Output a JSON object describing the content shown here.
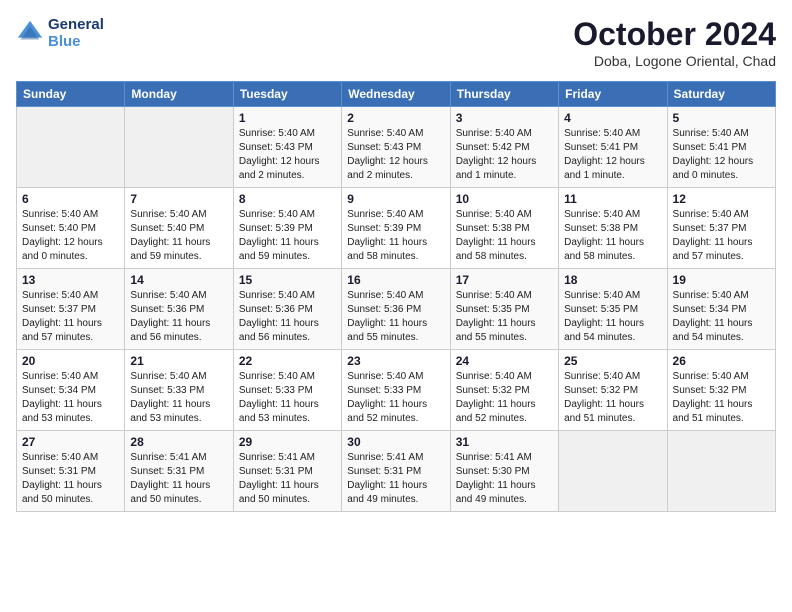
{
  "header": {
    "logo_line1": "General",
    "logo_line2": "Blue",
    "month": "October 2024",
    "location": "Doba, Logone Oriental, Chad"
  },
  "weekdays": [
    "Sunday",
    "Monday",
    "Tuesday",
    "Wednesday",
    "Thursday",
    "Friday",
    "Saturday"
  ],
  "weeks": [
    [
      {
        "day": "",
        "sunrise": "",
        "sunset": "",
        "daylight": ""
      },
      {
        "day": "",
        "sunrise": "",
        "sunset": "",
        "daylight": ""
      },
      {
        "day": "1",
        "sunrise": "Sunrise: 5:40 AM",
        "sunset": "Sunset: 5:43 PM",
        "daylight": "Daylight: 12 hours and 2 minutes."
      },
      {
        "day": "2",
        "sunrise": "Sunrise: 5:40 AM",
        "sunset": "Sunset: 5:43 PM",
        "daylight": "Daylight: 12 hours and 2 minutes."
      },
      {
        "day": "3",
        "sunrise": "Sunrise: 5:40 AM",
        "sunset": "Sunset: 5:42 PM",
        "daylight": "Daylight: 12 hours and 1 minute."
      },
      {
        "day": "4",
        "sunrise": "Sunrise: 5:40 AM",
        "sunset": "Sunset: 5:41 PM",
        "daylight": "Daylight: 12 hours and 1 minute."
      },
      {
        "day": "5",
        "sunrise": "Sunrise: 5:40 AM",
        "sunset": "Sunset: 5:41 PM",
        "daylight": "Daylight: 12 hours and 0 minutes."
      }
    ],
    [
      {
        "day": "6",
        "sunrise": "Sunrise: 5:40 AM",
        "sunset": "Sunset: 5:40 PM",
        "daylight": "Daylight: 12 hours and 0 minutes."
      },
      {
        "day": "7",
        "sunrise": "Sunrise: 5:40 AM",
        "sunset": "Sunset: 5:40 PM",
        "daylight": "Daylight: 11 hours and 59 minutes."
      },
      {
        "day": "8",
        "sunrise": "Sunrise: 5:40 AM",
        "sunset": "Sunset: 5:39 PM",
        "daylight": "Daylight: 11 hours and 59 minutes."
      },
      {
        "day": "9",
        "sunrise": "Sunrise: 5:40 AM",
        "sunset": "Sunset: 5:39 PM",
        "daylight": "Daylight: 11 hours and 58 minutes."
      },
      {
        "day": "10",
        "sunrise": "Sunrise: 5:40 AM",
        "sunset": "Sunset: 5:38 PM",
        "daylight": "Daylight: 11 hours and 58 minutes."
      },
      {
        "day": "11",
        "sunrise": "Sunrise: 5:40 AM",
        "sunset": "Sunset: 5:38 PM",
        "daylight": "Daylight: 11 hours and 58 minutes."
      },
      {
        "day": "12",
        "sunrise": "Sunrise: 5:40 AM",
        "sunset": "Sunset: 5:37 PM",
        "daylight": "Daylight: 11 hours and 57 minutes."
      }
    ],
    [
      {
        "day": "13",
        "sunrise": "Sunrise: 5:40 AM",
        "sunset": "Sunset: 5:37 PM",
        "daylight": "Daylight: 11 hours and 57 minutes."
      },
      {
        "day": "14",
        "sunrise": "Sunrise: 5:40 AM",
        "sunset": "Sunset: 5:36 PM",
        "daylight": "Daylight: 11 hours and 56 minutes."
      },
      {
        "day": "15",
        "sunrise": "Sunrise: 5:40 AM",
        "sunset": "Sunset: 5:36 PM",
        "daylight": "Daylight: 11 hours and 56 minutes."
      },
      {
        "day": "16",
        "sunrise": "Sunrise: 5:40 AM",
        "sunset": "Sunset: 5:36 PM",
        "daylight": "Daylight: 11 hours and 55 minutes."
      },
      {
        "day": "17",
        "sunrise": "Sunrise: 5:40 AM",
        "sunset": "Sunset: 5:35 PM",
        "daylight": "Daylight: 11 hours and 55 minutes."
      },
      {
        "day": "18",
        "sunrise": "Sunrise: 5:40 AM",
        "sunset": "Sunset: 5:35 PM",
        "daylight": "Daylight: 11 hours and 54 minutes."
      },
      {
        "day": "19",
        "sunrise": "Sunrise: 5:40 AM",
        "sunset": "Sunset: 5:34 PM",
        "daylight": "Daylight: 11 hours and 54 minutes."
      }
    ],
    [
      {
        "day": "20",
        "sunrise": "Sunrise: 5:40 AM",
        "sunset": "Sunset: 5:34 PM",
        "daylight": "Daylight: 11 hours and 53 minutes."
      },
      {
        "day": "21",
        "sunrise": "Sunrise: 5:40 AM",
        "sunset": "Sunset: 5:33 PM",
        "daylight": "Daylight: 11 hours and 53 minutes."
      },
      {
        "day": "22",
        "sunrise": "Sunrise: 5:40 AM",
        "sunset": "Sunset: 5:33 PM",
        "daylight": "Daylight: 11 hours and 53 minutes."
      },
      {
        "day": "23",
        "sunrise": "Sunrise: 5:40 AM",
        "sunset": "Sunset: 5:33 PM",
        "daylight": "Daylight: 11 hours and 52 minutes."
      },
      {
        "day": "24",
        "sunrise": "Sunrise: 5:40 AM",
        "sunset": "Sunset: 5:32 PM",
        "daylight": "Daylight: 11 hours and 52 minutes."
      },
      {
        "day": "25",
        "sunrise": "Sunrise: 5:40 AM",
        "sunset": "Sunset: 5:32 PM",
        "daylight": "Daylight: 11 hours and 51 minutes."
      },
      {
        "day": "26",
        "sunrise": "Sunrise: 5:40 AM",
        "sunset": "Sunset: 5:32 PM",
        "daylight": "Daylight: 11 hours and 51 minutes."
      }
    ],
    [
      {
        "day": "27",
        "sunrise": "Sunrise: 5:40 AM",
        "sunset": "Sunset: 5:31 PM",
        "daylight": "Daylight: 11 hours and 50 minutes."
      },
      {
        "day": "28",
        "sunrise": "Sunrise: 5:41 AM",
        "sunset": "Sunset: 5:31 PM",
        "daylight": "Daylight: 11 hours and 50 minutes."
      },
      {
        "day": "29",
        "sunrise": "Sunrise: 5:41 AM",
        "sunset": "Sunset: 5:31 PM",
        "daylight": "Daylight: 11 hours and 50 minutes."
      },
      {
        "day": "30",
        "sunrise": "Sunrise: 5:41 AM",
        "sunset": "Sunset: 5:31 PM",
        "daylight": "Daylight: 11 hours and 49 minutes."
      },
      {
        "day": "31",
        "sunrise": "Sunrise: 5:41 AM",
        "sunset": "Sunset: 5:30 PM",
        "daylight": "Daylight: 11 hours and 49 minutes."
      },
      {
        "day": "",
        "sunrise": "",
        "sunset": "",
        "daylight": ""
      },
      {
        "day": "",
        "sunrise": "",
        "sunset": "",
        "daylight": ""
      }
    ]
  ]
}
